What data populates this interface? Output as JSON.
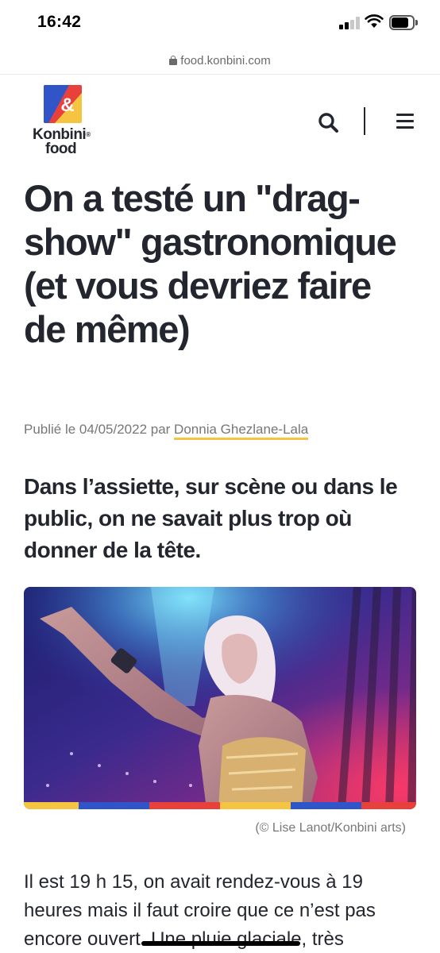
{
  "status_bar": {
    "time": "16:42"
  },
  "browser": {
    "url": "food.konbini.com"
  },
  "header": {
    "logo_line1": "Konbini",
    "logo_line2": "food",
    "logo_colors": [
      "#2f55c8",
      "#e8403a",
      "#f5c542"
    ],
    "icons": [
      "search-icon",
      "menu-icon"
    ]
  },
  "article": {
    "headline": "On a testé un \"drag-show\" gastronomique (et vous devriez faire de même)",
    "byline_prefix": "Publié le 04/05/2022 par",
    "author": "Donnia Ghezlane-Lala",
    "lede": "Dans l’assiette, sur scène ou dans le public, on ne savait plus trop où donner de la tête.",
    "image_caption": "(© Lise Lanot/Konbini arts)",
    "image_border_colors": [
      "#f5c542",
      "#2f55c8",
      "#e8403a"
    ],
    "body": "Il est 19 h 15, on avait rendez-vous à 19 heures mais il faut croire que ce n’est pas encore ouvert. Une pluie glaciale, très"
  }
}
